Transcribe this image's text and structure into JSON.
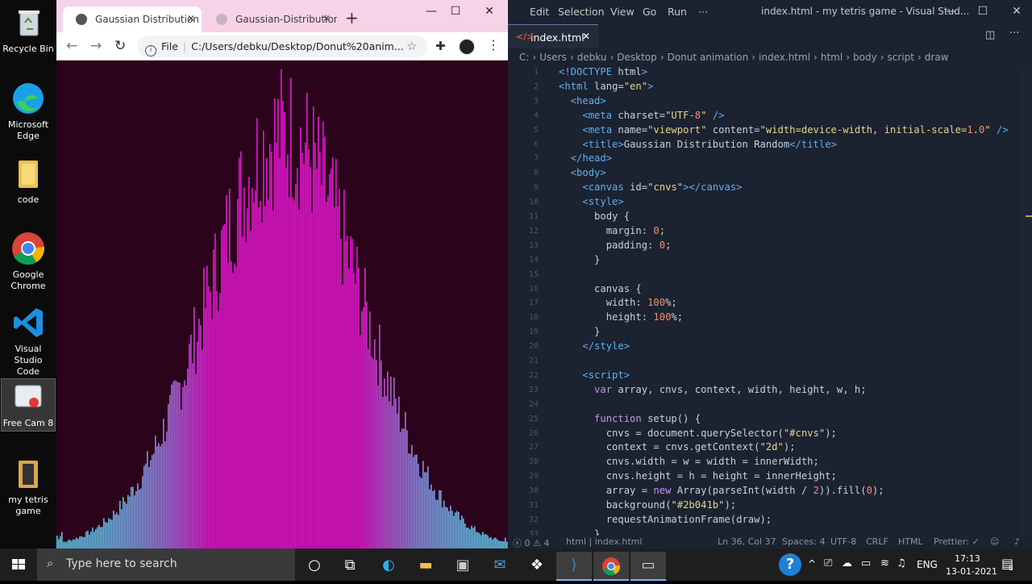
{
  "desktop": {
    "icons": [
      {
        "label": "Recycle Bin",
        "icon": "recycle-bin-icon"
      },
      {
        "label": "Microsoft Edge",
        "icon": "edge-icon"
      },
      {
        "label": "code",
        "icon": "folder-icon"
      },
      {
        "label": "Google Chrome",
        "icon": "chrome-icon"
      },
      {
        "label": "Visual Studio Code",
        "icon": "vscode-icon"
      },
      {
        "label": "Free Cam 8",
        "icon": "freecam-icon"
      },
      {
        "label": "my tetris game",
        "icon": "folder-icon"
      }
    ]
  },
  "chrome": {
    "tabs": [
      {
        "title": "Gaussian Distribution"
      },
      {
        "title": "Gaussian-Distribution"
      }
    ],
    "address": {
      "scheme": "File",
      "url": "C:/Users/debku/Desktop/Donut%20anim..."
    },
    "page": {
      "background": "#2b041b"
    }
  },
  "vscode": {
    "menu": [
      "Edit",
      "Selection",
      "View",
      "Go",
      "Run",
      "···"
    ],
    "window_title": "index.html - my tetris game - Visual Stud...",
    "active_tab": "index.html",
    "breadcrumb": [
      "C:",
      "Users",
      "debku",
      "Desktop",
      "Donut animation",
      "index.html",
      "html",
      "body",
      "script",
      "draw"
    ],
    "code_lines": [
      "<!DOCTYPE html>",
      "<html lang=\"en\">",
      "  <head>",
      "    <meta charset=\"UTF-8\" />",
      "    <meta name=\"viewport\" content=\"width=device-width, initial-scale=1.0\" />",
      "    <title>Gaussian Distribution Random</title>",
      "  </head>",
      "  <body>",
      "    <canvas id=\"cnvs\"></canvas>",
      "    <style>",
      "      body {",
      "        margin: 0;",
      "        padding: 0;",
      "      }",
      "",
      "      canvas {",
      "        width: 100%;",
      "        height: 100%;",
      "      }",
      "    </style>",
      "",
      "    <script>",
      "      var array, cnvs, context, width, height, w, h;",
      "",
      "      function setup() {",
      "        cnvs = document.querySelector(\"#cnvs\");",
      "        context = cnvs.getContext(\"2d\");",
      "        cnvs.width = w = width = innerWidth;",
      "        cnvs.height = h = height = innerHeight;",
      "        array = new Array(parseInt(width / 2)).fill(0);",
      "        background(\"#2b041b\");",
      "        requestAnimationFrame(draw);",
      "      }"
    ],
    "status": {
      "problems": "ⓧ 0 ⚠ 4",
      "lang_crumb": "html | index.html",
      "position": "Ln 36, Col 37",
      "spaces": "Spaces: 4",
      "encoding": "UTF-8",
      "eol": "CRLF",
      "language": "HTML",
      "formatter": "Prettier: ✓"
    }
  },
  "taskbar": {
    "search_placeholder": "Type here to search",
    "language": "ENG",
    "time": "17:13",
    "date": "13-01-2021",
    "notification_count": "8"
  }
}
